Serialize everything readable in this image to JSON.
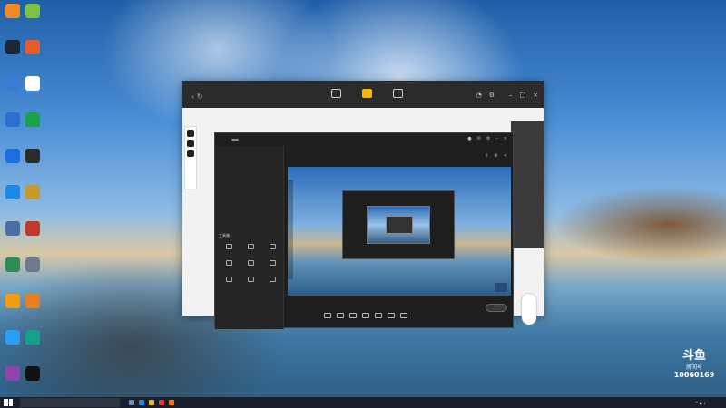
{
  "desktop": {
    "icons_col1": [
      {
        "label": "",
        "icon": "folder-icon",
        "color": "#f08a24"
      },
      {
        "label": "",
        "icon": "chat-icon",
        "color": "#7cc243"
      },
      {
        "label": "",
        "icon": "steam-icon",
        "color": "#1b2838"
      },
      {
        "label": "",
        "icon": "app-icon",
        "color": "#e85b2b"
      },
      {
        "label": "",
        "icon": "cloud-icon",
        "color": "#3a7bd5"
      },
      {
        "label": "",
        "icon": "doc-icon",
        "color": "#ffffff"
      },
      {
        "label": "",
        "icon": "app-icon",
        "color": "#2b6fd1"
      },
      {
        "label": "",
        "icon": "app-icon",
        "color": "#1aa34a"
      },
      {
        "label": "",
        "icon": "app-icon",
        "color": "#1d6fe0"
      },
      {
        "label": "",
        "icon": "game-icon",
        "color": "#2b2b2b"
      },
      {
        "label": "",
        "icon": "edge-icon",
        "color": "#1e88e5"
      },
      {
        "label": "",
        "icon": "game-icon",
        "color": "#c79a2b"
      },
      {
        "label": "",
        "icon": "app-icon",
        "color": "#4a6fa5"
      },
      {
        "label": "",
        "icon": "app-icon",
        "color": "#c0392b"
      },
      {
        "label": "",
        "icon": "app-icon",
        "color": "#2e8b57"
      },
      {
        "label": "",
        "icon": "app-icon",
        "color": "#6d7b8d"
      },
      {
        "label": "",
        "icon": "app-icon",
        "color": "#f39c12"
      },
      {
        "label": "",
        "icon": "app-icon",
        "color": "#e67e22"
      },
      {
        "label": "",
        "icon": "app-icon",
        "color": "#2a9df4"
      },
      {
        "label": "",
        "icon": "app-icon",
        "color": "#16a085"
      },
      {
        "label": "",
        "icon": "app-icon",
        "color": "#8e44ad"
      },
      {
        "label": "",
        "icon": "qq-icon",
        "color": "#111111"
      }
    ]
  },
  "window": {
    "title": "",
    "toolbar_buttons": [
      "",
      "",
      ""
    ],
    "user": ""
  },
  "app": {
    "logo": "",
    "tag": "",
    "tabs": [
      "",
      "",
      ""
    ],
    "scene": "",
    "tools_title": "工具箱",
    "tools": [
      "",
      "",
      "",
      "",
      "",
      "",
      "",
      "",
      ""
    ],
    "footer": "",
    "info_line1": "",
    "info_line2": "",
    "bottom_buttons": [
      "",
      "",
      "",
      "",
      "",
      "",
      ""
    ]
  },
  "room_badge": {
    "brand": "斗鱼",
    "label": "房间号",
    "number": "10060169"
  },
  "taskbar": {
    "search_placeholder": "",
    "time": "",
    "date": ""
  }
}
